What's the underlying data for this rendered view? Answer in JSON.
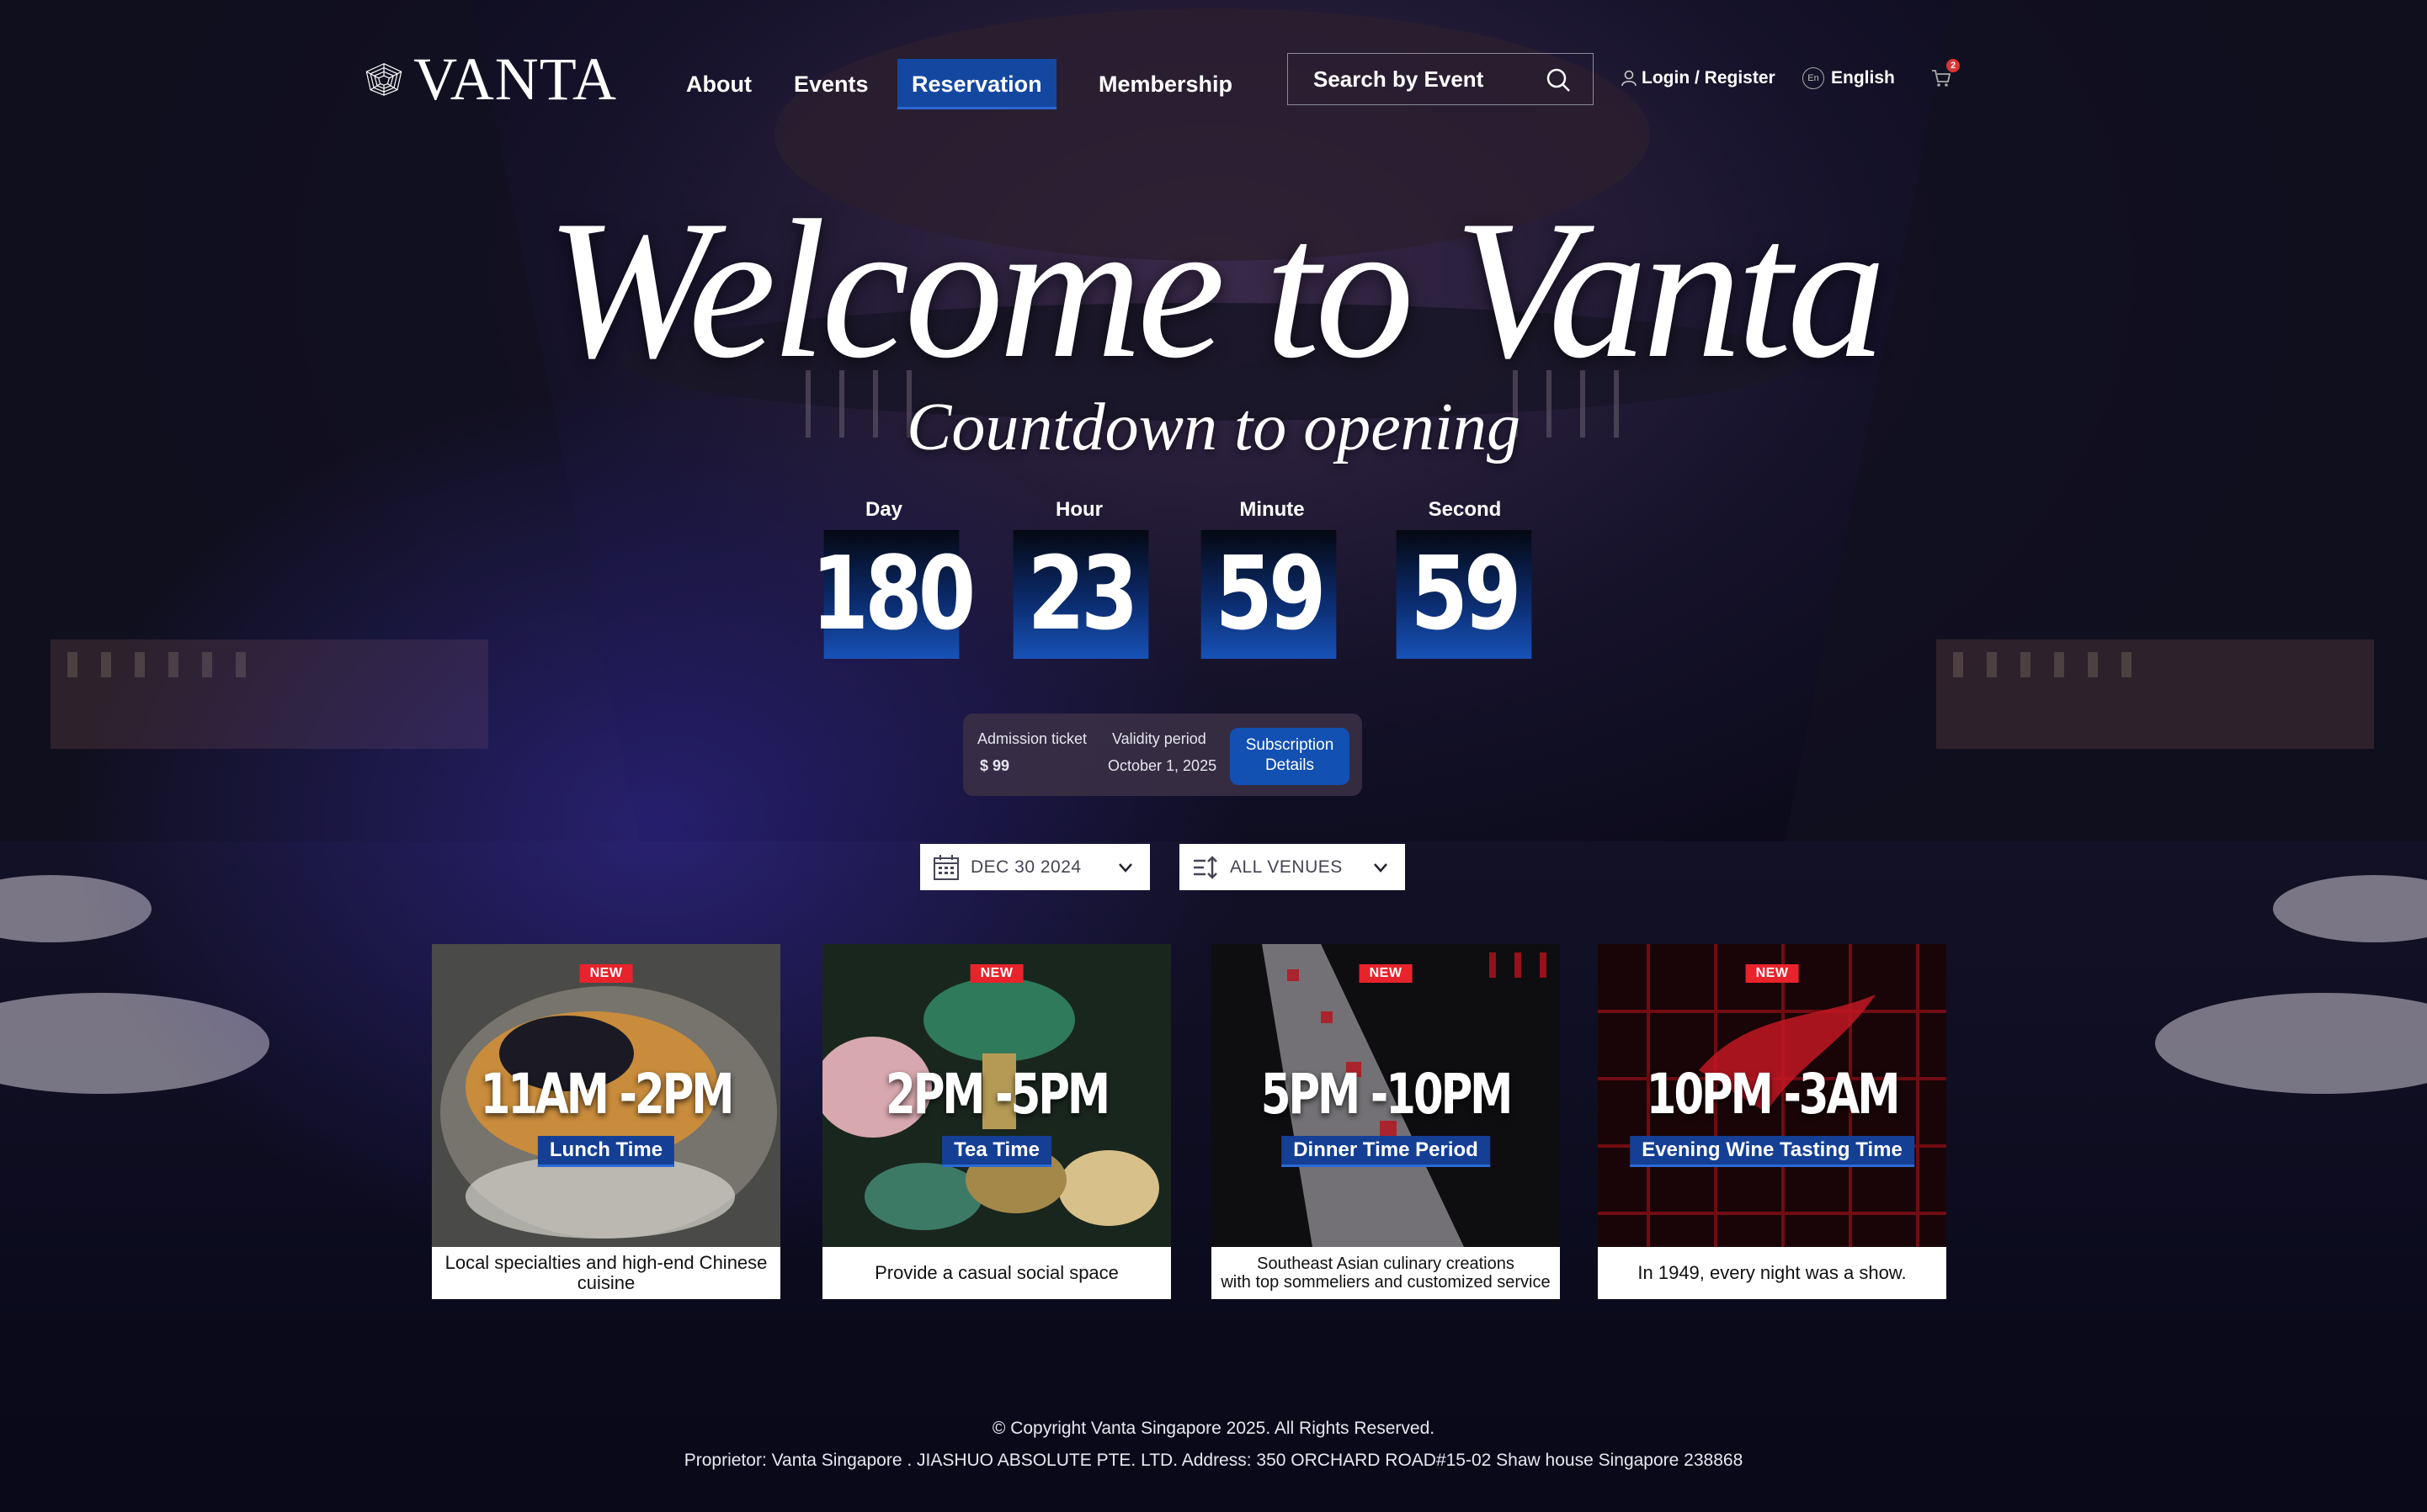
{
  "brand": {
    "name": "VANTA"
  },
  "nav": {
    "items": [
      {
        "label": "About"
      },
      {
        "label": "Events"
      },
      {
        "label": "Reservation",
        "active": true
      },
      {
        "label": "Membership"
      }
    ]
  },
  "search": {
    "placeholder": "Search by Event",
    "icon": "search-icon"
  },
  "account": {
    "login_label": "Login / Register",
    "language": "English",
    "lang_icon": "En",
    "cart_count": "2"
  },
  "hero": {
    "title": "Welcome to Vanta",
    "subtitle": "Countdown to opening",
    "countdown": [
      {
        "label": "Day",
        "value": "180"
      },
      {
        "label": "Hour",
        "value": "23"
      },
      {
        "label": "Minute",
        "value": "59"
      },
      {
        "label": "Second",
        "value": "59"
      }
    ]
  },
  "ticket": {
    "admission_label": "Admission ticket",
    "price": "$ 99",
    "validity_label": "Validity period",
    "validity_date": "October 1, 2025",
    "button_label": "Subscription\nDetails"
  },
  "filters": {
    "date": "DEC 30 2024",
    "venue": "ALL VENUES"
  },
  "sessions": [
    {
      "badge": "NEW",
      "time": "11AM -2PM",
      "name": "Lunch Time",
      "desc": "Local specialties and high-end Chinese cuisine"
    },
    {
      "badge": "NEW",
      "time": "2PM -5PM",
      "name": "Tea Time",
      "desc": "Provide a casual social space"
    },
    {
      "badge": "NEW",
      "time": "5PM -10PM",
      "name": "Dinner Time Period",
      "desc": "Southeast Asian culinary creations\nwith top sommeliers and customized service"
    },
    {
      "badge": "NEW",
      "time": "10PM -3AM",
      "name": "Evening Wine Tasting Time",
      "desc": "In 1949, every night was a show."
    }
  ],
  "footer": {
    "copyright": "© Copyright Vanta Singapore 2025. All Rights Reserved.",
    "address": "Proprietor: Vanta Singapore . JIASHUO ABSOLUTE PTE. LTD.  Address: 350 ORCHARD ROAD#15-02 Shaw house  Singapore 238868"
  },
  "colors": {
    "accent": "#1447a0",
    "badge": "#e8232b",
    "background": "#0c0b1c"
  }
}
